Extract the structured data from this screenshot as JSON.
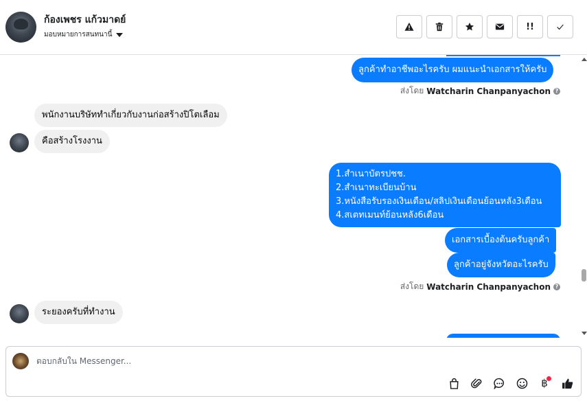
{
  "header": {
    "name": "ก้องเพชร แก้วมาดย์",
    "subtitle": "มอบหมายการสนทนานี้",
    "actions": [
      {
        "name": "report-button",
        "icon": "warning-icon"
      },
      {
        "name": "delete-button",
        "icon": "trash-icon"
      },
      {
        "name": "star-button",
        "icon": "star-icon"
      },
      {
        "name": "mark-unread-button",
        "icon": "envelope-icon",
        "label": ""
      },
      {
        "name": "follow-up-button",
        "icon": "follow-up-icon",
        "label": "!!"
      },
      {
        "name": "done-button",
        "icon": "check-icon"
      }
    ]
  },
  "messages": {
    "m1": "ลูกค้าทำอาชีพอะไรครับ ผมแนะนำเอกสารให้ครับ",
    "sent_prefix": "ส่งโดย",
    "sent_by": "Watcharin Chanpanyachon",
    "m2": "พนักงานบริษัททำเกี่ยวกับงานก่อสร้างปิโตเลือม",
    "m3": "คือสร้างโรงงาน",
    "m4_lines": [
      "1.สำเนาบัตรปชช.",
      "2.สำเนาทะเบียนบ้าน",
      "3.หนังสือรับรองเงินเดือน/สลิปเงินเดือนย้อนหลัง3เดือน",
      "4.สเตทเมนท์ย้อนหลัง6เดือน"
    ],
    "m5": "เอกสารเบื้องต้นครับลูกค้า",
    "m6": "ลูกค้าอยู่จังหวัดอะไรครับ",
    "m7": "ระยองครับที่ทำงาน"
  },
  "composer": {
    "placeholder": "ตอบกลับใน Messenger...",
    "tools": [
      "bag-icon",
      "attachment-icon",
      "saved-replies-icon",
      "emoji-icon",
      "payment-icon",
      "thumbs-up-icon"
    ],
    "baht_symbol": "฿"
  },
  "colors": {
    "outgoing": "#0a7cff",
    "incoming": "#f0f0f0",
    "notification_dot": "#f02849"
  }
}
